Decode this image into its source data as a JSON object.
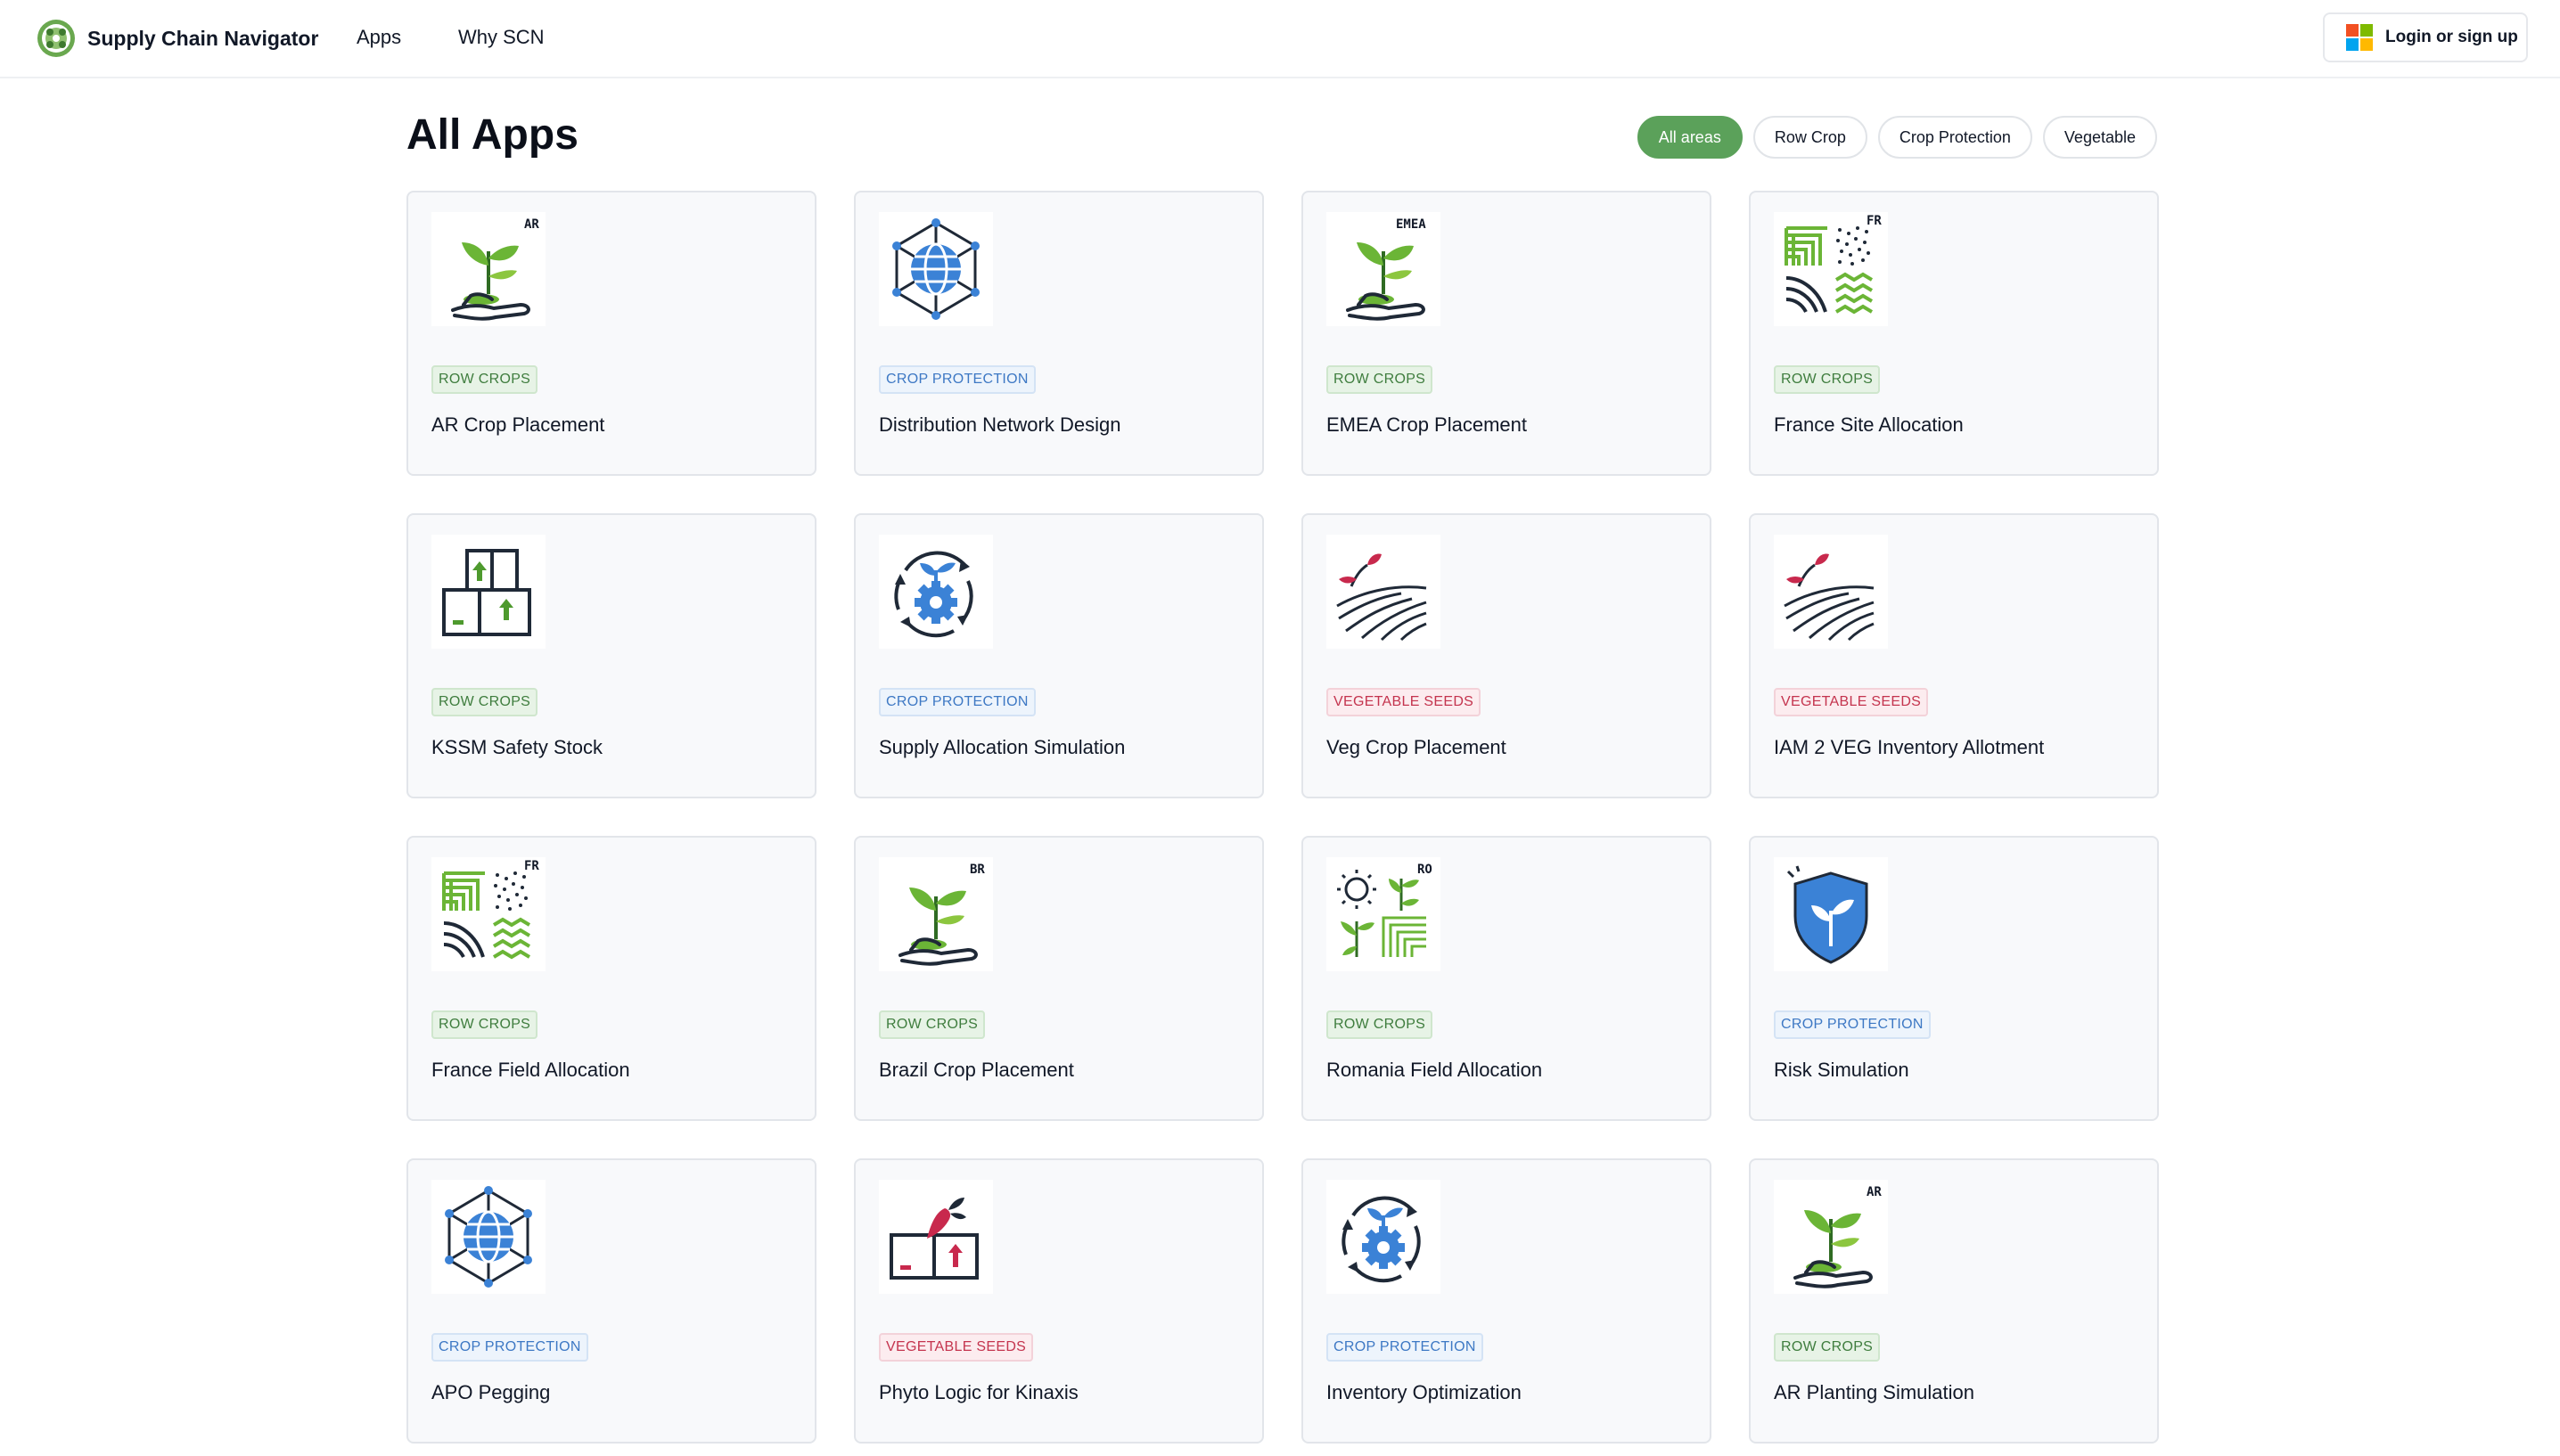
{
  "header": {
    "brand": "Supply Chain Navigator",
    "nav": [
      "Apps",
      "Why SCN"
    ],
    "login_label": "Login or sign up"
  },
  "page": {
    "title": "All Apps",
    "filters": [
      {
        "label": "All areas",
        "active": true
      },
      {
        "label": "Row Crop",
        "active": false
      },
      {
        "label": "Crop Protection",
        "active": false
      },
      {
        "label": "Vegetable",
        "active": false
      }
    ]
  },
  "colors": {
    "accent_green": "#5ba15a",
    "row_crops": "#3f7d3e",
    "crop_protection": "#3d78c4",
    "vegetable_seeds": "#c4344e"
  },
  "apps": [
    {
      "title": "AR Crop Placement",
      "tag": "ROW CROPS",
      "icon": "hand-plant-icon",
      "icon_label": "AR"
    },
    {
      "title": "Distribution Network Design",
      "tag": "CROP PROTECTION",
      "icon": "globe-network-icon"
    },
    {
      "title": "EMEA Crop Placement",
      "tag": "ROW CROPS",
      "icon": "hand-plant-icon",
      "icon_label": "EMEA"
    },
    {
      "title": "France Site Allocation",
      "tag": "ROW CROPS",
      "icon": "field-pattern-icon",
      "icon_label": "FR"
    },
    {
      "title": "KSSM Safety Stock",
      "tag": "ROW CROPS",
      "icon": "stock-boxes-icon"
    },
    {
      "title": "Supply Allocation Simulation",
      "tag": "CROP PROTECTION",
      "icon": "cycle-gear-plant-icon"
    },
    {
      "title": "Veg Crop Placement",
      "tag": "VEGETABLE SEEDS",
      "icon": "sprout-furrows-icon"
    },
    {
      "title": "IAM 2 VEG Inventory Allotment",
      "tag": "VEGETABLE SEEDS",
      "icon": "sprout-furrows-icon"
    },
    {
      "title": "France Field Allocation",
      "tag": "ROW CROPS",
      "icon": "field-pattern-icon",
      "icon_label": "FR"
    },
    {
      "title": "Brazil Crop Placement",
      "tag": "ROW CROPS",
      "icon": "hand-plant-icon",
      "icon_label": "BR"
    },
    {
      "title": "Romania Field Allocation",
      "tag": "ROW CROPS",
      "icon": "sun-field-icon",
      "icon_label": "RO"
    },
    {
      "title": "Risk Simulation",
      "tag": "CROP PROTECTION",
      "icon": "shield-plant-icon"
    },
    {
      "title": "APO Pegging",
      "tag": "CROP PROTECTION",
      "icon": "globe-network-icon"
    },
    {
      "title": "Phyto Logic for Kinaxis",
      "tag": "VEGETABLE SEEDS",
      "icon": "veg-box-icon"
    },
    {
      "title": "Inventory Optimization",
      "tag": "CROP PROTECTION",
      "icon": "cycle-gear-plant-icon"
    },
    {
      "title": "AR Planting Simulation",
      "tag": "ROW CROPS",
      "icon": "hand-plant-icon",
      "icon_label": "AR"
    }
  ]
}
